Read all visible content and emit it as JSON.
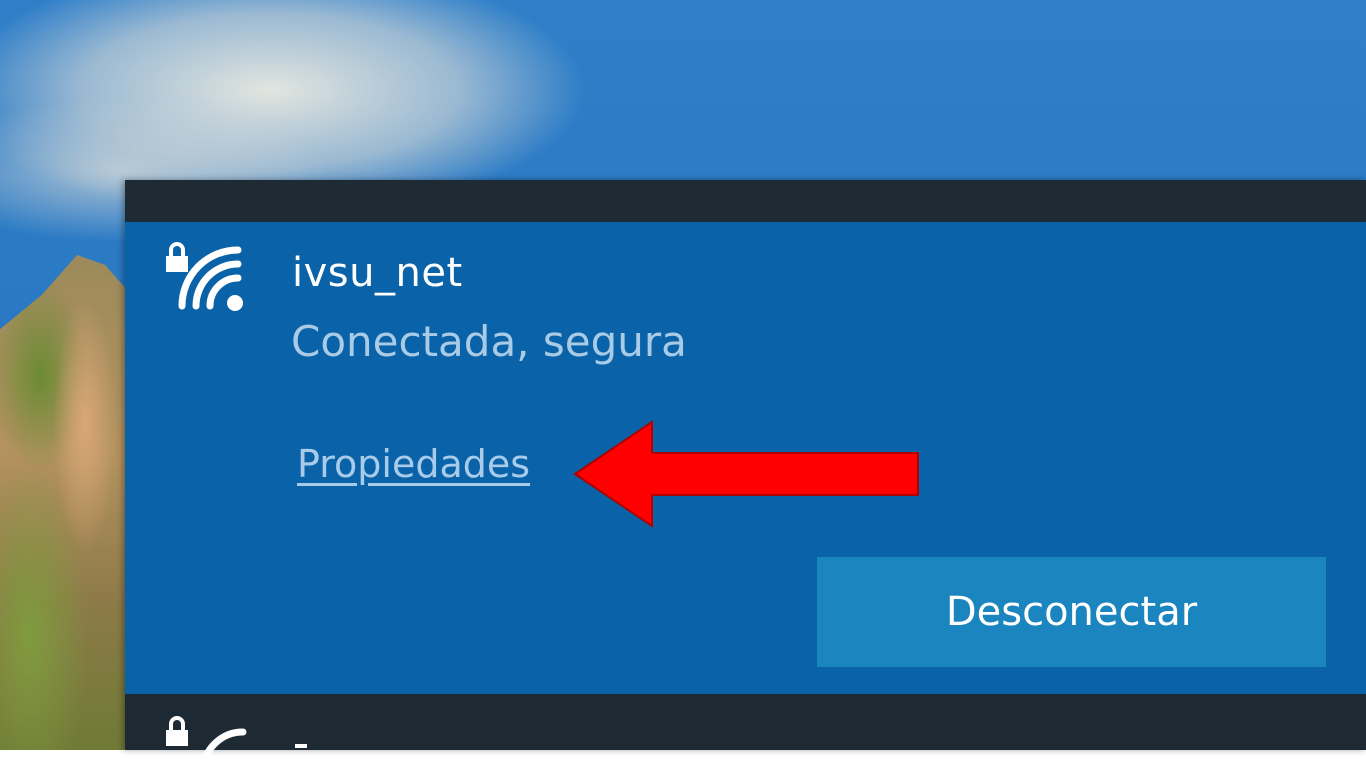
{
  "network": {
    "name": "ivsu_net",
    "status": "Conectada, segura",
    "properties_link": "Propiedades",
    "disconnect_label": "Desconectar"
  },
  "icons": {
    "wifi": "wifi-secured-icon",
    "lock": "lock-icon",
    "annotation": "red-arrow-icon"
  },
  "colors": {
    "flyout_bg": "#1e2a33",
    "selected_item_bg": "#0a63a8",
    "button_bg": "#1a85be",
    "link_color": "#a7cbe8",
    "arrow_color": "#ff0000"
  }
}
